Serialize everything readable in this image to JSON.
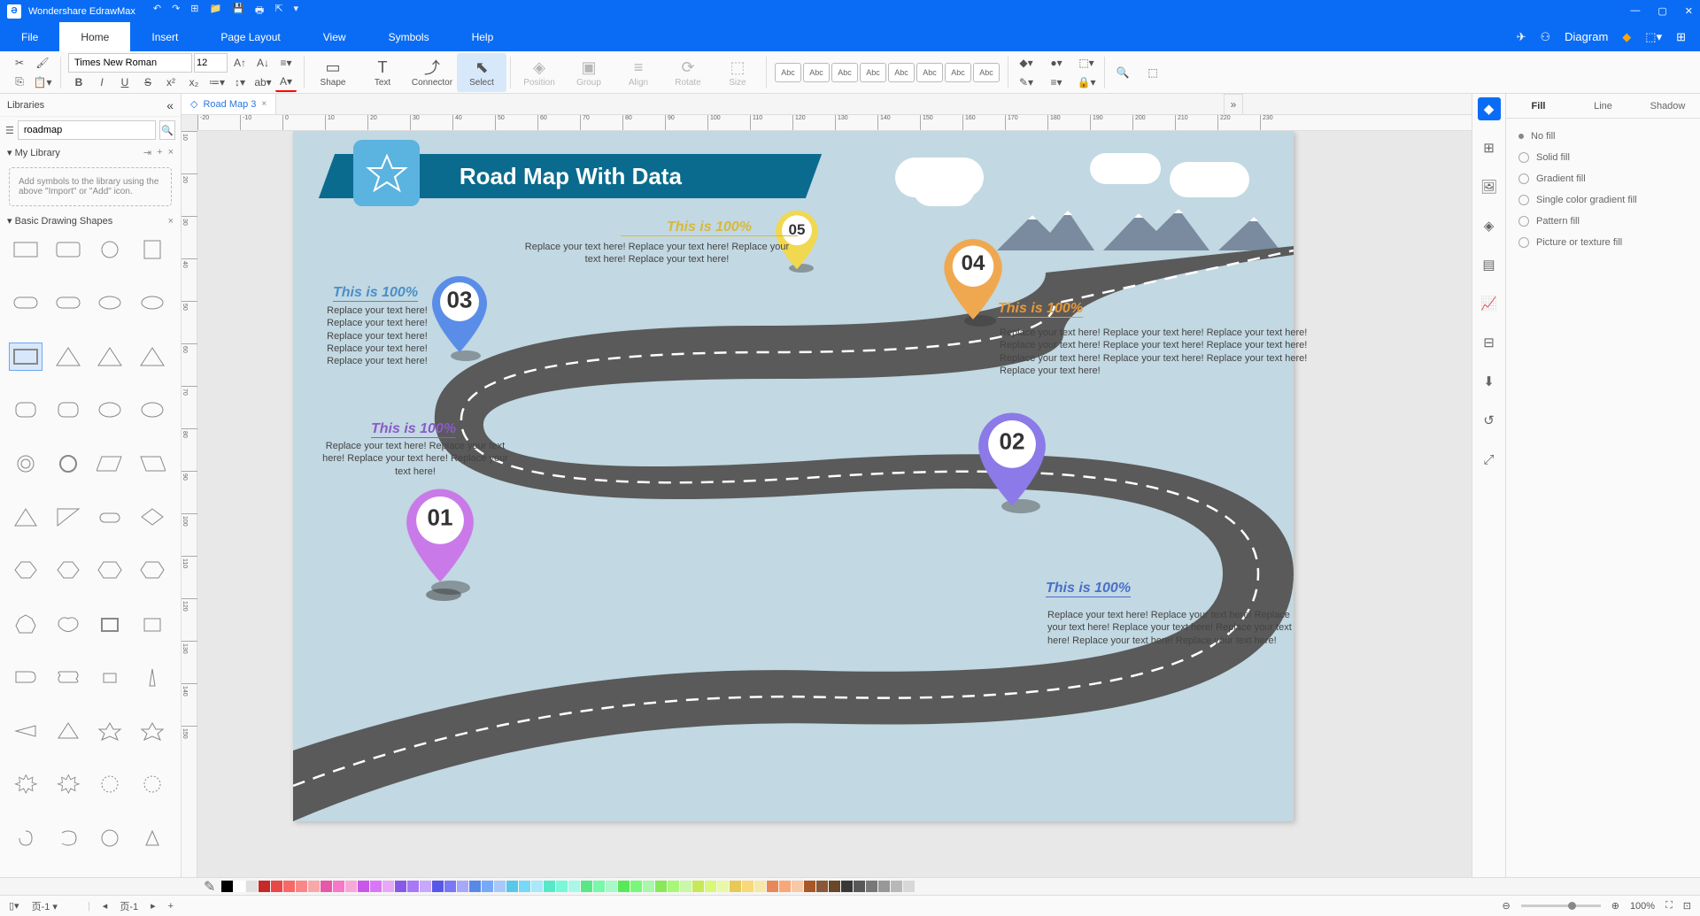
{
  "app": {
    "title": "Wondershare EdrawMax"
  },
  "menubar": {
    "tabs": [
      "File",
      "Home",
      "Insert",
      "Page Layout",
      "View",
      "Symbols",
      "Help"
    ],
    "active": 1,
    "diagram_label": "Diagram"
  },
  "ribbon": {
    "font_name": "Times New Roman",
    "font_size": "12",
    "big_buttons": [
      {
        "label": "Shape",
        "icon": "▭"
      },
      {
        "label": "Text",
        "icon": "T"
      },
      {
        "label": "Connector",
        "icon": "⤴"
      },
      {
        "label": "Select",
        "icon": "⬉"
      },
      {
        "label": "Position",
        "icon": "◈"
      },
      {
        "label": "Group",
        "icon": "▣"
      },
      {
        "label": "Align",
        "icon": "≡"
      },
      {
        "label": "Rotate",
        "icon": "⟳"
      },
      {
        "label": "Size",
        "icon": "⬚"
      }
    ],
    "styles": [
      "Abc",
      "Abc",
      "Abc",
      "Abc",
      "Abc",
      "Abc",
      "Abc",
      "Abc"
    ]
  },
  "left": {
    "header": "Libraries",
    "search_value": "roadmap",
    "mylib": "My Library",
    "import_hint": "Add symbols to the library using the above \"Import\" or \"Add\" icon.",
    "shapes_header": "Basic Drawing Shapes"
  },
  "doc": {
    "tab_name": "Road Map 3",
    "ruler_h": [
      "-20",
      "-10",
      "0",
      "10",
      "20",
      "30",
      "40",
      "50",
      "60",
      "70",
      "80",
      "90",
      "100",
      "110",
      "120",
      "130",
      "140",
      "150",
      "160",
      "170",
      "180",
      "190",
      "200",
      "210",
      "220",
      "230"
    ],
    "ruler_v": [
      "10",
      "20",
      "30",
      "40",
      "50",
      "60",
      "70",
      "80",
      "90",
      "100",
      "110",
      "120",
      "130",
      "140",
      "150"
    ]
  },
  "roadmap": {
    "title": "Road Map With Data",
    "pins": [
      {
        "num": "01",
        "color": "#c97ae8",
        "heading": "This is 100%",
        "heading_color": "#8a5bc9",
        "body": "Replace your text here! Replace your text here! Replace your text here!  Replace your text here!"
      },
      {
        "num": "02",
        "color": "#8b7ae8",
        "heading": "This is 100%",
        "heading_color": "#4a6fc9",
        "body": "Replace your text here! Replace your text here! Replace your text here!  Replace your text here! Replace your text here!  Replace your text here! Replace your text here!"
      },
      {
        "num": "03",
        "color": "#5a8de8",
        "heading": "This is 100%",
        "heading_color": "#4a8fc9",
        "body": "Replace your text here! Replace your text here! Replace your text here! Replace your text here! Replace your text here!"
      },
      {
        "num": "04",
        "color": "#f0a850",
        "heading": "This is 100%",
        "heading_color": "#e89838",
        "body": "Replace your text here! Replace your text here! Replace your text here!  Replace your text here! Replace your text here! Replace your text here! Replace your text here!  Replace your text here!  Replace your text here! Replace your text here!"
      },
      {
        "num": "05",
        "color": "#f0d850",
        "heading": "This is 100%",
        "heading_color": "#d8b838",
        "body": "Replace your text here! Replace your text here! Replace your text here!  Replace your text here!"
      }
    ]
  },
  "right": {
    "tabs": [
      "Fill",
      "Line",
      "Shadow"
    ],
    "active": 0,
    "fill_opts": [
      "No fill",
      "Solid fill",
      "Gradient fill",
      "Single color gradient fill",
      "Pattern fill",
      "Picture or texture fill"
    ]
  },
  "colors": [
    "#000000",
    "#ffffff",
    "#e0e0e0",
    "#c82828",
    "#e84848",
    "#f86868",
    "#f88888",
    "#f8a8a8",
    "#e858a8",
    "#f878c8",
    "#f8a8d8",
    "#c858e8",
    "#d878f8",
    "#e8a8f8",
    "#8858e8",
    "#a878f8",
    "#c8a8f8",
    "#5858e8",
    "#7878f8",
    "#a8a8f8",
    "#5888e8",
    "#78a8f8",
    "#a8c8f8",
    "#58c8e8",
    "#78d8f8",
    "#a8e8f8",
    "#58e8c8",
    "#78f8d8",
    "#a8f8e8",
    "#58e888",
    "#78f8a8",
    "#a8f8c8",
    "#58e858",
    "#78f878",
    "#a8f8a8",
    "#88e858",
    "#a8f878",
    "#c8f8a8",
    "#c8e858",
    "#d8f878",
    "#e8f8a8",
    "#e8c858",
    "#f8d878",
    "#f8e8a8",
    "#e88858",
    "#f8a878",
    "#f8c8a8",
    "#a85828",
    "#885838",
    "#684828",
    "#383838",
    "#585858",
    "#787878",
    "#989898",
    "#b8b8b8",
    "#d8d8d8"
  ],
  "status": {
    "page_label": "页-1",
    "page_nav": "页-1",
    "zoom": "100%"
  }
}
